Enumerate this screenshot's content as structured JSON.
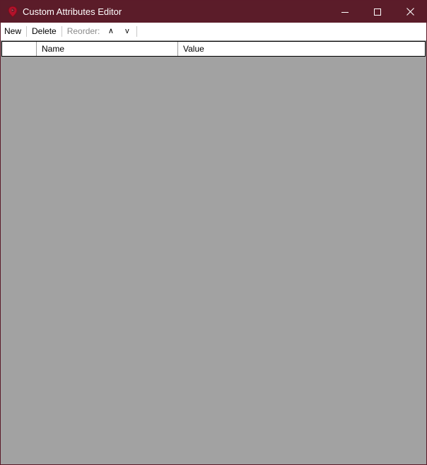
{
  "window": {
    "title": "Custom Attributes Editor",
    "titlebar_color": "#5b1c29",
    "background_color": "#a2a2a2"
  },
  "titlebar": {
    "app_icon": "app-logo-icon",
    "buttons": [
      {
        "name": "minimize",
        "icon": "minimize-icon"
      },
      {
        "name": "maximize",
        "icon": "maximize-icon"
      },
      {
        "name": "close",
        "icon": "close-icon"
      }
    ]
  },
  "toolbar": {
    "new_label": "New",
    "delete_label": "Delete",
    "reorder_label": "Reorder:",
    "move_up_label": "∧",
    "move_down_label": "v"
  },
  "grid": {
    "columns": [
      "",
      "Name",
      "Value"
    ],
    "rows": []
  }
}
